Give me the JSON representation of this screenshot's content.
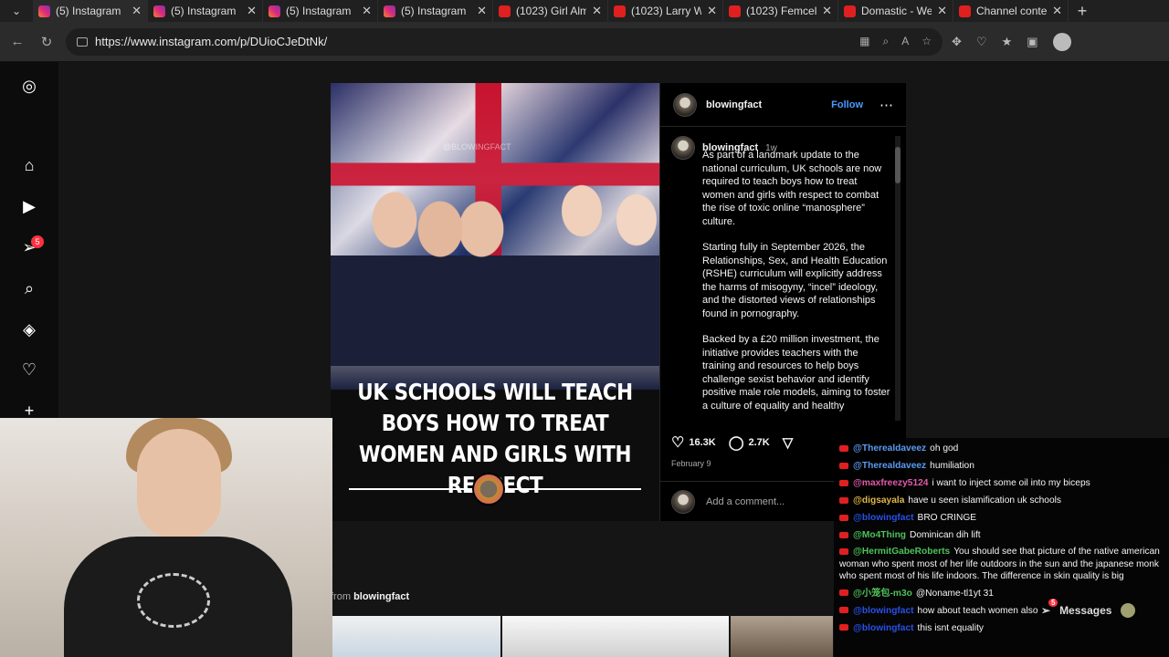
{
  "browser": {
    "tabs": [
      {
        "title": "(5) Instagram",
        "icon": "instagram-favicon",
        "active": true
      },
      {
        "title": "(5) Instagram",
        "icon": "instagram-favicon",
        "active": false
      },
      {
        "title": "(5) Instagram",
        "icon": "instagram-favicon",
        "active": false
      },
      {
        "title": "(5) Instagram",
        "icon": "instagram-favicon",
        "active": false
      },
      {
        "title": "(1023) Girl Almo",
        "icon": "youtube-favicon",
        "active": false
      },
      {
        "title": "(1023) Larry Wh",
        "icon": "youtube-favicon",
        "active": false
      },
      {
        "title": "(1023) Femcel F",
        "icon": "youtube-favicon",
        "active": false
      },
      {
        "title": "Domastic - Weir",
        "icon": "youtube-favicon",
        "active": false
      },
      {
        "title": "Channel conten",
        "icon": "youtube-favicon",
        "active": false
      }
    ],
    "url": "https://www.instagram.com/p/DUioCJeDtNk/"
  },
  "sidebar": {
    "notification_count": "5"
  },
  "post": {
    "username": "blowingfact",
    "follow_label": "Follow",
    "time_ago": "1w",
    "media_headline": "UK SCHOOLS WILL TEACH BOYS HOW TO TREAT WOMEN AND GIRLS WITH RESPECT",
    "media_watermark": "@BLOWINGFACT",
    "caption_paragraphs": [
      "As part of a landmark update to the national curriculum, UK schools are now required to teach boys how to treat women and girls with respect to combat the rise of toxic online “manosphere” culture.",
      "Starting fully in September 2026, the Relationships, Sex, and Health Education (RSHE) curriculum will explicitly address the harms of misogyny, “incel” ideology, and the distorted views of relationships found in pornography.",
      "Backed by a £20 million investment, the initiative provides teachers with the training and resources to help boys challenge sexist behavior and identify positive male role models, aiming to foster a culture of equality and healthy"
    ],
    "likes": "16.3K",
    "comments": "2.7K",
    "date": "February 9",
    "comment_placeholder": "Add a comment..."
  },
  "more_from": {
    "prefix": "from",
    "user": "blowingfact"
  },
  "messages_label": "Messages",
  "messages_badge": "5",
  "chat": [
    {
      "user": "@Therealdaveez",
      "color": "#5b9bf0",
      "text": "oh god"
    },
    {
      "user": "@Therealdaveez",
      "color": "#5b9bf0",
      "text": "humiliation"
    },
    {
      "user": "@maxfreezy5124",
      "color": "#e05aa8",
      "text": "i want to inject some oil into my biceps"
    },
    {
      "user": "@digsayala",
      "color": "#e0b84a",
      "text": "have u seen islamification uk schools"
    },
    {
      "user": "@blowingfact",
      "color": "#2a50e8",
      "text": "BRO CRINGE"
    },
    {
      "user": "@Mo4Thing",
      "color": "#4ec25a",
      "text": "Dominican dih lift"
    },
    {
      "user": "@HermitGabeRoberts",
      "color": "#4ec25a",
      "text": "You should see that picture of the native american woman who spent most of her life outdoors in the sun and the japanese monk who spent most of his life indoors. The difference in skin quality is big"
    },
    {
      "user": "@小笼包-m3o",
      "color": "#4ec25a",
      "text": "@Noname-tl1yt 31"
    },
    {
      "user": "@blowingfact",
      "color": "#2a50e8",
      "text": "how about teach women also"
    },
    {
      "user": "@blowingfact",
      "color": "#2a50e8",
      "text": "this isnt equality"
    }
  ],
  "colors": {
    "accent": "#4c9aff",
    "badge": "#ff3040",
    "youtube": "#e02020"
  }
}
